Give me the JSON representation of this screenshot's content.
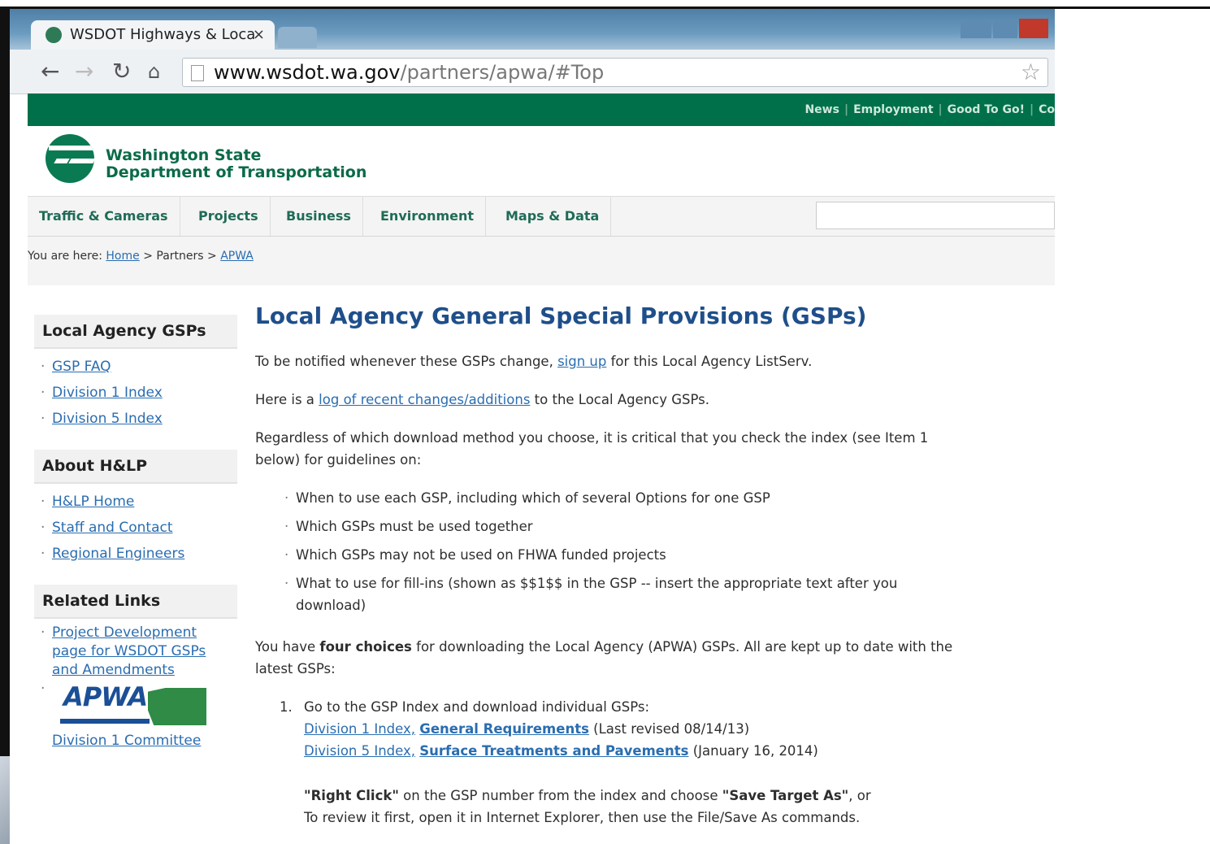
{
  "browser": {
    "tab_title": "WSDOT Highways & Loca",
    "tab_close": "×",
    "url_host": "www.wsdot.wa.gov",
    "url_path": "/partners/apwa/#Top"
  },
  "top_links": [
    "News",
    "Employment",
    "Good To Go!",
    "Co"
  ],
  "org": {
    "line1": "Washington State",
    "line2": "Department of Transportation"
  },
  "main_nav": [
    "Traffic & Cameras",
    "Projects",
    "Business",
    "Environment",
    "Maps & Data"
  ],
  "breadcrumb": {
    "prefix": "You are here:",
    "home": "Home",
    "sep1": ">",
    "partners": "Partners",
    "sep2": ">",
    "current": "APWA"
  },
  "sidebar": {
    "local_head": "Local Agency GSPs",
    "local_items": [
      "GSP FAQ",
      "Division 1 Index",
      "Division 5 Index"
    ],
    "about_head": "About H&LP",
    "about_items": [
      "H&LP Home",
      "Staff and Contact",
      "Regional Engineers"
    ],
    "related_head": "Related Links",
    "related_link": "Project Development page for WSDOT GSPs and Amendments",
    "apwa_logo": "APWA",
    "apwa_caption": "Division 1 Committee"
  },
  "content": {
    "title": "Local Agency General Special Provisions (GSPs)",
    "p1_pre": "To be notified whenever these GSPs change,",
    "p1_link": "sign up",
    "p1_post": "for this Local Agency ListServ.",
    "p2_pre": "Here is a",
    "p2_link": "log of recent changes/additions",
    "p2_post": "to the Local Agency GSPs.",
    "p3": "Regardless of which download method you choose, it is critical that you check the index (see Item 1 below) for guidelines on:",
    "bullets": [
      "When to use each GSP, including which of several Options for one GSP",
      "Which GSPs must be used together",
      "Which GSPs may not be used on FHWA funded projects",
      "What to use for fill-ins (shown as $$1$$ in the GSP -- insert the appropriate text after you download)"
    ],
    "p4_pre": "You have",
    "p4_bold": "four choices",
    "p4_post": "for downloading the Local Agency (APWA) GSPs. All are kept up to date with the latest GSPs:",
    "item1_num": "1.",
    "item1_text": "Go to the GSP Index and download individual GSPs:",
    "div1_link": "Division 1 Index,",
    "div1_bold": "General Requirements",
    "div1_date": "(Last revised 08/14/13)",
    "div5_link": "Division 5 Index,",
    "div5_bold": "Surface Treatments and Pavements",
    "div5_date": "(January 16, 2014)",
    "rc_bold1": "\"Right Click\"",
    "rc_mid": "on the GSP number from the index and choose",
    "rc_bold2": "\"Save Target As\"",
    "rc_end": ", or",
    "review": "To review it first, open it in Internet Explorer, then use the File/Save As commands."
  },
  "colors": {
    "green": "#00704a",
    "link": "#2a6db0",
    "title": "#1f4f8a"
  }
}
